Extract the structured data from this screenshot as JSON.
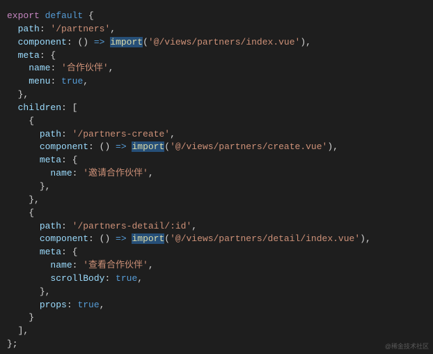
{
  "code": {
    "l1": {
      "export": "export",
      "default": "default",
      "brace": " {"
    },
    "l2": {
      "indent": "  ",
      "prop": "path",
      "colon": ": ",
      "val": "'/partners'",
      "comma": ","
    },
    "l3": {
      "indent": "  ",
      "prop": "component",
      "colon": ": ",
      "fn": "() ",
      "arrow": "=>",
      "sp": " ",
      "imp": "import",
      "open": "(",
      "arg": "'@/views/partners/index.vue'",
      "close": "),",
      "pad": ""
    },
    "l4": {
      "indent": "  ",
      "prop": "meta",
      "colon": ": {"
    },
    "l5": {
      "indent": "    ",
      "prop": "name",
      "colon": ": ",
      "val": "'合作伙伴'",
      "comma": ","
    },
    "l6": {
      "indent": "    ",
      "prop": "menu",
      "colon": ": ",
      "val": "true",
      "comma": ","
    },
    "l7": {
      "indent": "  ",
      "close": "},"
    },
    "l8": {
      "indent": "  ",
      "prop": "children",
      "colon": ": ["
    },
    "l9": {
      "indent": "    ",
      "brace": "{"
    },
    "l10": {
      "indent": "      ",
      "prop": "path",
      "colon": ": ",
      "val": "'/partners-create'",
      "comma": ","
    },
    "l11": {
      "indent": "      ",
      "prop": "component",
      "colon": ": ",
      "fn": "() ",
      "arrow": "=>",
      "sp": " ",
      "imp": "import",
      "open": "(",
      "arg": "'@/views/partners/create.vue'",
      "close": "),",
      "pad": ""
    },
    "l12": {
      "indent": "      ",
      "prop": "meta",
      "colon": ": {"
    },
    "l13": {
      "indent": "        ",
      "prop": "name",
      "colon": ": ",
      "val": "'邀请合作伙伴'",
      "comma": ","
    },
    "l14": {
      "indent": "      ",
      "close": "},"
    },
    "l15": {
      "indent": "    ",
      "close": "},"
    },
    "l16": {
      "indent": "    ",
      "brace": "{"
    },
    "l17": {
      "indent": "      ",
      "prop": "path",
      "colon": ": ",
      "val": "'/partners-detail/:id'",
      "comma": ","
    },
    "l18": {
      "indent": "      ",
      "prop": "component",
      "colon": ": ",
      "fn": "() ",
      "arrow": "=>",
      "sp": " ",
      "imp": "import",
      "open": "(",
      "arg": "'@/views/partners/detail/index.vue'",
      "close": "),",
      "pad": ""
    },
    "l19": {
      "indent": "      ",
      "prop": "meta",
      "colon": ": {"
    },
    "l20": {
      "indent": "        ",
      "prop": "name",
      "colon": ": ",
      "val": "'查看合作伙伴'",
      "comma": ","
    },
    "l21": {
      "indent": "        ",
      "prop": "scrollBody",
      "colon": ": ",
      "val": "true",
      "comma": ","
    },
    "l22": {
      "indent": "      ",
      "close": "},"
    },
    "l23": {
      "indent": "      ",
      "prop": "props",
      "colon": ": ",
      "val": "true",
      "comma": ","
    },
    "l24": {
      "indent": "    ",
      "close": "}"
    },
    "l25": {
      "indent": "  ",
      "close": "],"
    },
    "l26": {
      "close": "};"
    }
  },
  "watermark": "@稀金技术社区"
}
